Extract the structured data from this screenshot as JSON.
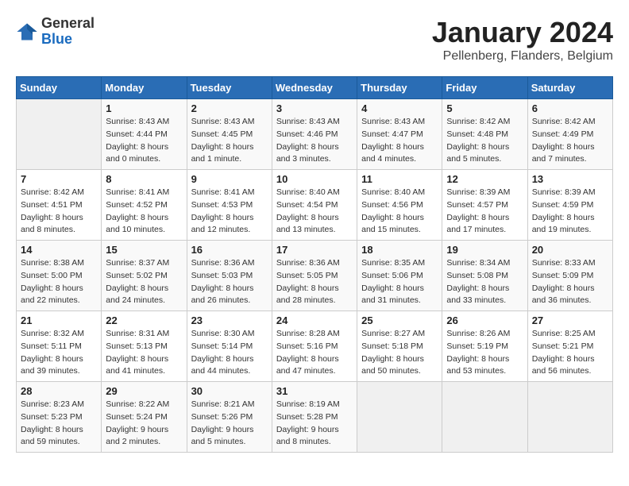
{
  "header": {
    "logo_general": "General",
    "logo_blue": "Blue",
    "month": "January 2024",
    "location": "Pellenberg, Flanders, Belgium"
  },
  "days_of_week": [
    "Sunday",
    "Monday",
    "Tuesday",
    "Wednesday",
    "Thursday",
    "Friday",
    "Saturday"
  ],
  "weeks": [
    [
      {
        "day": "",
        "info": ""
      },
      {
        "day": "1",
        "info": "Sunrise: 8:43 AM\nSunset: 4:44 PM\nDaylight: 8 hours\nand 0 minutes."
      },
      {
        "day": "2",
        "info": "Sunrise: 8:43 AM\nSunset: 4:45 PM\nDaylight: 8 hours\nand 1 minute."
      },
      {
        "day": "3",
        "info": "Sunrise: 8:43 AM\nSunset: 4:46 PM\nDaylight: 8 hours\nand 3 minutes."
      },
      {
        "day": "4",
        "info": "Sunrise: 8:43 AM\nSunset: 4:47 PM\nDaylight: 8 hours\nand 4 minutes."
      },
      {
        "day": "5",
        "info": "Sunrise: 8:42 AM\nSunset: 4:48 PM\nDaylight: 8 hours\nand 5 minutes."
      },
      {
        "day": "6",
        "info": "Sunrise: 8:42 AM\nSunset: 4:49 PM\nDaylight: 8 hours\nand 7 minutes."
      }
    ],
    [
      {
        "day": "7",
        "info": "Sunrise: 8:42 AM\nSunset: 4:51 PM\nDaylight: 8 hours\nand 8 minutes."
      },
      {
        "day": "8",
        "info": "Sunrise: 8:41 AM\nSunset: 4:52 PM\nDaylight: 8 hours\nand 10 minutes."
      },
      {
        "day": "9",
        "info": "Sunrise: 8:41 AM\nSunset: 4:53 PM\nDaylight: 8 hours\nand 12 minutes."
      },
      {
        "day": "10",
        "info": "Sunrise: 8:40 AM\nSunset: 4:54 PM\nDaylight: 8 hours\nand 13 minutes."
      },
      {
        "day": "11",
        "info": "Sunrise: 8:40 AM\nSunset: 4:56 PM\nDaylight: 8 hours\nand 15 minutes."
      },
      {
        "day": "12",
        "info": "Sunrise: 8:39 AM\nSunset: 4:57 PM\nDaylight: 8 hours\nand 17 minutes."
      },
      {
        "day": "13",
        "info": "Sunrise: 8:39 AM\nSunset: 4:59 PM\nDaylight: 8 hours\nand 19 minutes."
      }
    ],
    [
      {
        "day": "14",
        "info": "Sunrise: 8:38 AM\nSunset: 5:00 PM\nDaylight: 8 hours\nand 22 minutes."
      },
      {
        "day": "15",
        "info": "Sunrise: 8:37 AM\nSunset: 5:02 PM\nDaylight: 8 hours\nand 24 minutes."
      },
      {
        "day": "16",
        "info": "Sunrise: 8:36 AM\nSunset: 5:03 PM\nDaylight: 8 hours\nand 26 minutes."
      },
      {
        "day": "17",
        "info": "Sunrise: 8:36 AM\nSunset: 5:05 PM\nDaylight: 8 hours\nand 28 minutes."
      },
      {
        "day": "18",
        "info": "Sunrise: 8:35 AM\nSunset: 5:06 PM\nDaylight: 8 hours\nand 31 minutes."
      },
      {
        "day": "19",
        "info": "Sunrise: 8:34 AM\nSunset: 5:08 PM\nDaylight: 8 hours\nand 33 minutes."
      },
      {
        "day": "20",
        "info": "Sunrise: 8:33 AM\nSunset: 5:09 PM\nDaylight: 8 hours\nand 36 minutes."
      }
    ],
    [
      {
        "day": "21",
        "info": "Sunrise: 8:32 AM\nSunset: 5:11 PM\nDaylight: 8 hours\nand 39 minutes."
      },
      {
        "day": "22",
        "info": "Sunrise: 8:31 AM\nSunset: 5:13 PM\nDaylight: 8 hours\nand 41 minutes."
      },
      {
        "day": "23",
        "info": "Sunrise: 8:30 AM\nSunset: 5:14 PM\nDaylight: 8 hours\nand 44 minutes."
      },
      {
        "day": "24",
        "info": "Sunrise: 8:28 AM\nSunset: 5:16 PM\nDaylight: 8 hours\nand 47 minutes."
      },
      {
        "day": "25",
        "info": "Sunrise: 8:27 AM\nSunset: 5:18 PM\nDaylight: 8 hours\nand 50 minutes."
      },
      {
        "day": "26",
        "info": "Sunrise: 8:26 AM\nSunset: 5:19 PM\nDaylight: 8 hours\nand 53 minutes."
      },
      {
        "day": "27",
        "info": "Sunrise: 8:25 AM\nSunset: 5:21 PM\nDaylight: 8 hours\nand 56 minutes."
      }
    ],
    [
      {
        "day": "28",
        "info": "Sunrise: 8:23 AM\nSunset: 5:23 PM\nDaylight: 8 hours\nand 59 minutes."
      },
      {
        "day": "29",
        "info": "Sunrise: 8:22 AM\nSunset: 5:24 PM\nDaylight: 9 hours\nand 2 minutes."
      },
      {
        "day": "30",
        "info": "Sunrise: 8:21 AM\nSunset: 5:26 PM\nDaylight: 9 hours\nand 5 minutes."
      },
      {
        "day": "31",
        "info": "Sunrise: 8:19 AM\nSunset: 5:28 PM\nDaylight: 9 hours\nand 8 minutes."
      },
      {
        "day": "",
        "info": ""
      },
      {
        "day": "",
        "info": ""
      },
      {
        "day": "",
        "info": ""
      }
    ]
  ]
}
